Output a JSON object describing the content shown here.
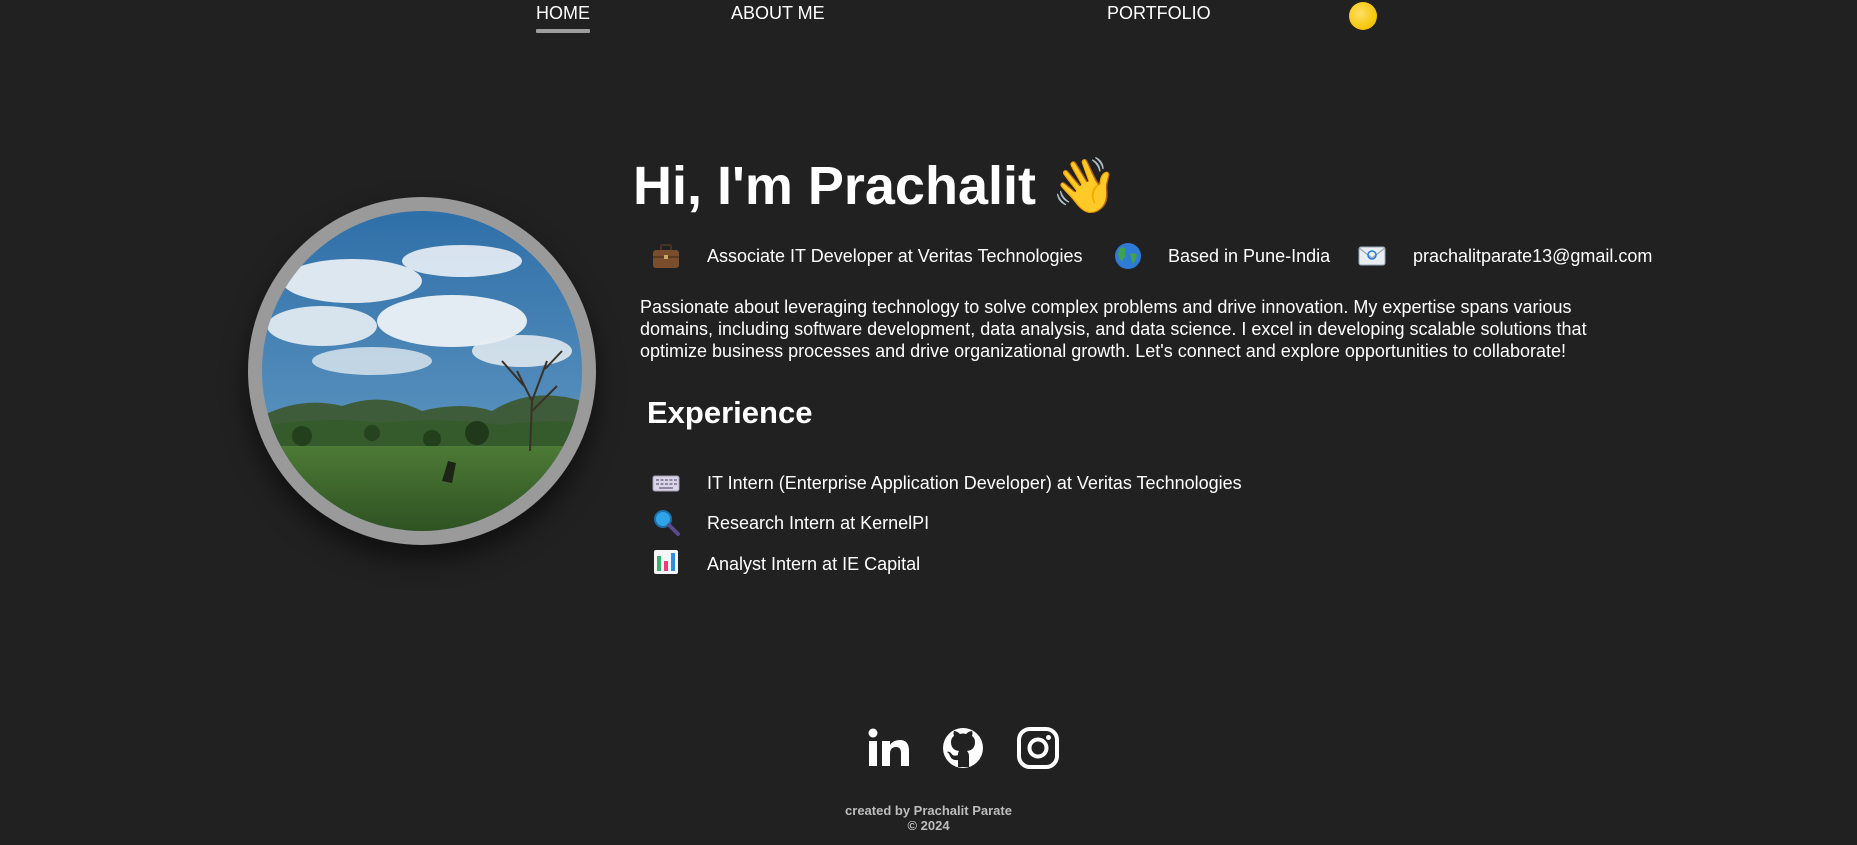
{
  "nav": {
    "home": "HOME",
    "about": "ABOUT ME",
    "portfolio": "PORTFOLIO"
  },
  "theme_toggle_icon": "sun-icon",
  "hero": {
    "title": "Hi, I'm Prachalit",
    "wave": "👋",
    "role": "Associate IT Developer at Veritas Technologies",
    "location": "Based in Pune-India",
    "email": "prachalitparate13@gmail.com",
    "bio": "Passionate about leveraging technology to solve complex problems and drive innovation. My expertise spans various domains, including software development, data analysis, and data science. I excel in developing scalable solutions that optimize business processes and drive organizational growth. Let's connect and explore opportunities to collaborate!"
  },
  "experience": {
    "heading": "Experience",
    "items": [
      {
        "icon": "keyboard-icon",
        "text": "IT Intern (Enterprise Application Developer) at Veritas Technologies"
      },
      {
        "icon": "magnifier-icon",
        "text": "Research Intern at KernelPI"
      },
      {
        "icon": "bar-chart-icon",
        "text": "Analyst Intern at IE Capital"
      }
    ]
  },
  "social": [
    "linkedin-icon",
    "github-icon",
    "instagram-icon"
  ],
  "footer": {
    "credit": "created by Prachalit Parate",
    "copyright": "© 2024"
  },
  "colors": {
    "background": "#212121",
    "text": "#ffffff",
    "nav_underline": "#9e9e9e",
    "avatar_ring": "#9a9a9a",
    "footer_text": "#bdbdbd"
  }
}
